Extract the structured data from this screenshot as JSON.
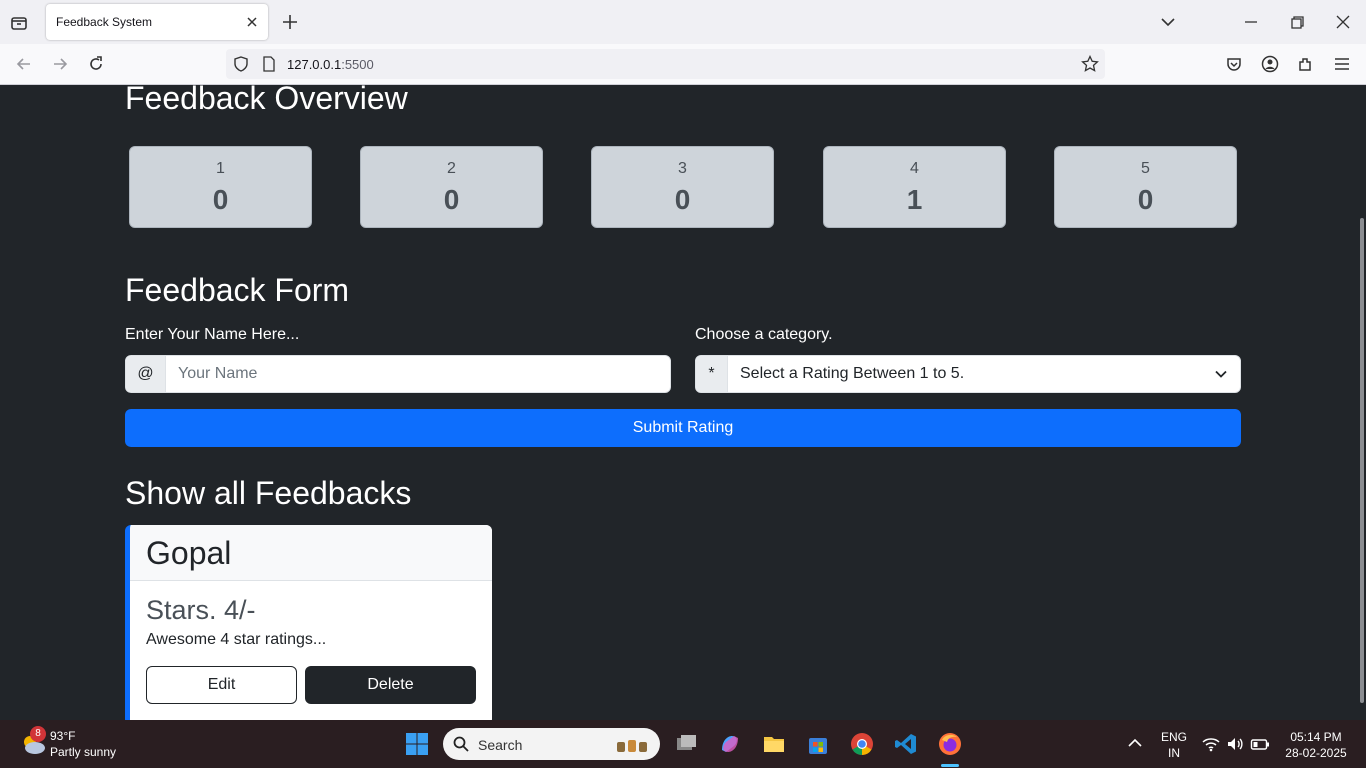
{
  "browser": {
    "tab_title": "Feedback System",
    "url_host": "127.0.0.1",
    "url_port": ":5500"
  },
  "overview": {
    "title": "Feedback Overview",
    "stats": [
      {
        "label": "1",
        "value": "0"
      },
      {
        "label": "2",
        "value": "0"
      },
      {
        "label": "3",
        "value": "0"
      },
      {
        "label": "4",
        "value": "1"
      },
      {
        "label": "5",
        "value": "0"
      }
    ]
  },
  "form": {
    "title": "Feedback Form",
    "name_label": "Enter Your Name Here...",
    "name_addon": "@",
    "name_placeholder": "Your Name",
    "category_label": "Choose a category.",
    "category_addon": "*",
    "category_selected": "Select a Rating Between 1 to 5.",
    "submit_label": "Submit Rating"
  },
  "feedbacks": {
    "title": "Show all Feedbacks",
    "items": [
      {
        "name": "Gopal",
        "stars": "Stars. 4/-",
        "text": "Awesome 4 star ratings...",
        "edit_label": "Edit",
        "delete_label": "Delete"
      }
    ]
  },
  "taskbar": {
    "weather_badge": "8",
    "weather_temp": "93°F",
    "weather_desc": "Partly sunny",
    "search_label": "Search",
    "lang": "ENG",
    "region": "IN",
    "time": "05:14 PM",
    "date": "28-02-2025"
  },
  "colors": {
    "page_bg": "#212529",
    "primary": "#0d6efd",
    "stat_bg": "#ced4da"
  }
}
